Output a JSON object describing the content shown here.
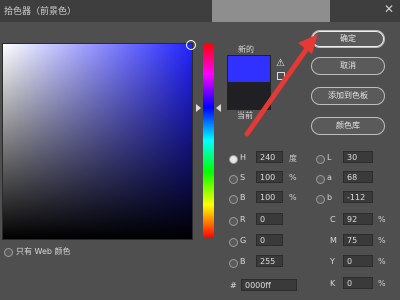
{
  "window": {
    "title": "拾色器（前景色）",
    "close_glyph": "✕"
  },
  "swatches": {
    "new_label": "新的",
    "current_label": "当前",
    "new_color": "#3030ff",
    "current_color": "#1f1f24"
  },
  "buttons": {
    "ok": "确定",
    "cancel": "取消",
    "add_to_swatches": "添加到色板",
    "color_libraries": "颜色库"
  },
  "web_only": {
    "label": "只有 Web 颜色"
  },
  "hsb": [
    {
      "key": "H",
      "value": "240",
      "unit": "度",
      "selected": true
    },
    {
      "key": "S",
      "value": "100",
      "unit": "%",
      "selected": false
    },
    {
      "key": "B",
      "value": "100",
      "unit": "%",
      "selected": false
    }
  ],
  "rgb": [
    {
      "key": "R",
      "value": "0"
    },
    {
      "key": "G",
      "value": "0"
    },
    {
      "key": "B",
      "value": "255"
    }
  ],
  "lab": [
    {
      "key": "L",
      "value": "30"
    },
    {
      "key": "a",
      "value": "68"
    },
    {
      "key": "b",
      "value": "-112"
    }
  ],
  "cmyk": [
    {
      "key": "C",
      "value": "92",
      "unit": "%"
    },
    {
      "key": "M",
      "value": "75",
      "unit": "%"
    },
    {
      "key": "Y",
      "value": "0",
      "unit": "%"
    },
    {
      "key": "K",
      "value": "0",
      "unit": "%"
    }
  ],
  "hex": {
    "key": "#",
    "value": "0000ff"
  },
  "icons": {
    "warning": "warning-icon",
    "cube": "web-safe-cube-icon"
  },
  "annotation": {
    "arrow_color": "#e53935"
  }
}
